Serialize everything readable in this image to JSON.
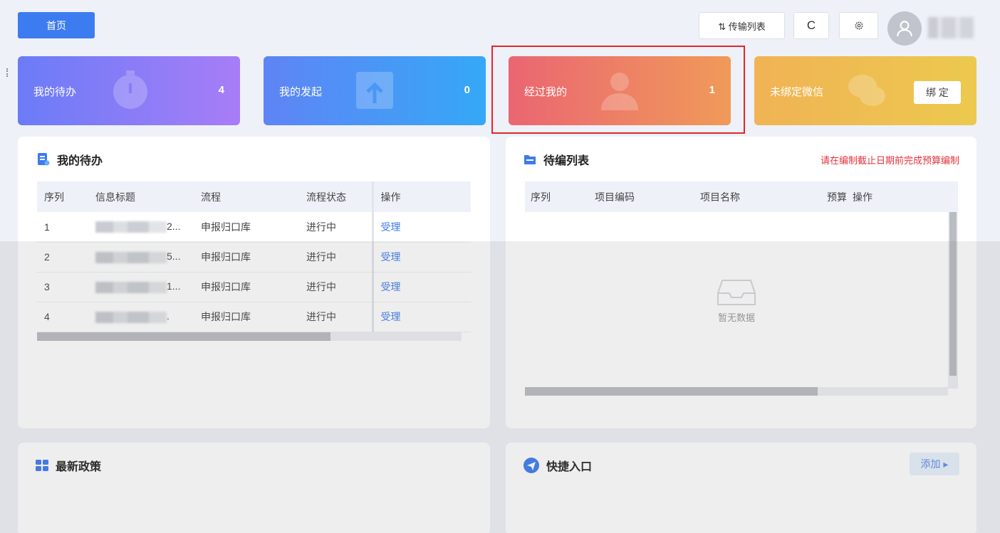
{
  "header": {
    "home_label": "首页",
    "transfer_label": "⇅ 传输列表",
    "refresh_label": "C",
    "settings_icon": "gear-icon",
    "avatar_icon": "user-icon"
  },
  "stats": {
    "todo": {
      "label": "我的待办",
      "value": "4"
    },
    "initiated": {
      "label": "我的发起",
      "value": "0"
    },
    "passed": {
      "label": "经过我的",
      "value": "1"
    },
    "wechat": {
      "label": "未绑定微信",
      "bind_label": "绑 定"
    }
  },
  "todo_panel": {
    "title": "我的待办",
    "columns": [
      "序列",
      "信息标题",
      "流程",
      "流程状态",
      "操作"
    ],
    "rows": [
      {
        "index": "1",
        "title_suffix": "2...",
        "process": "申报归口库",
        "status": "进行中",
        "action": "受理"
      },
      {
        "index": "2",
        "title_suffix": "5...",
        "process": "申报归口库",
        "status": "进行中",
        "action": "受理"
      },
      {
        "index": "3",
        "title_suffix": "1...",
        "process": "申报归口库",
        "status": "进行中",
        "action": "受理"
      },
      {
        "index": "4",
        "title_suffix": ".",
        "process": "申报归口库",
        "status": "进行中",
        "action": "受理"
      }
    ]
  },
  "edit_panel": {
    "title": "待编列表",
    "notice": "请在编制截止日期前完成预算编制",
    "columns": [
      "序列",
      "项目编码",
      "项目名称",
      "预算",
      "操作"
    ],
    "empty_text": "暂无数据"
  },
  "policy_panel": {
    "title": "最新政策"
  },
  "quick_panel": {
    "title": "快捷入口",
    "add_label": "添加 ▸"
  },
  "colors": {
    "primary": "#3d7bf0",
    "notice": "#e5303a",
    "highlight": "#e0262c"
  }
}
